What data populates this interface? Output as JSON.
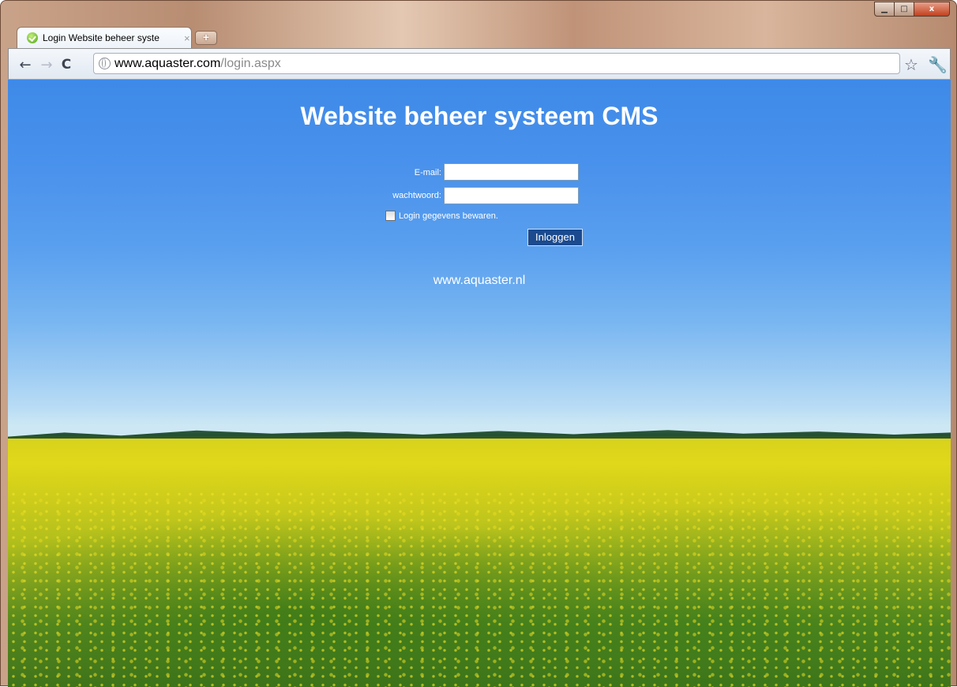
{
  "browser": {
    "tab": {
      "title": "Login Website beheer syste",
      "close": "×"
    },
    "new_tab": "+",
    "address": {
      "domain": "www.aquaster.com",
      "path": "/login.aspx"
    },
    "nav": {
      "back": "←",
      "forward": "→",
      "reload": "C"
    },
    "icons": {
      "star": "☆",
      "wrench": "🔧"
    },
    "window_controls": {
      "minimize": "▁",
      "maximize": "□",
      "close": "x"
    }
  },
  "page": {
    "title": "Website beheer systeem CMS",
    "form": {
      "email_label": "E-mail:",
      "email_value": "",
      "password_label": "wachtwoord:",
      "password_value": "",
      "remember_label": "Login gegevens bewaren.",
      "remember_checked": false,
      "submit_label": "Inloggen"
    },
    "site_link": "www.aquaster.nl"
  },
  "colors": {
    "sky": "#4a92ec",
    "button": "#1b4a8e",
    "field": "#d8d21c"
  }
}
